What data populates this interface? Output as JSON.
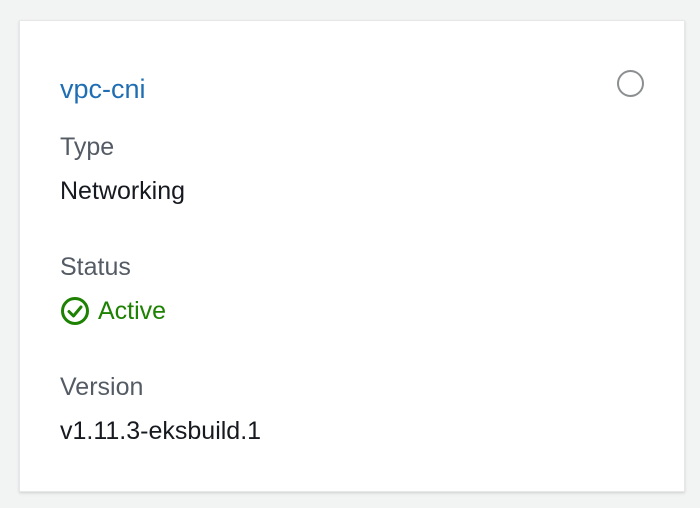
{
  "card": {
    "addon_name": "vpc-cni",
    "fields": {
      "type": {
        "label": "Type",
        "value": "Networking"
      },
      "status": {
        "label": "Status",
        "value": "Active",
        "icon": "check-circle-icon",
        "color": "#1d8102"
      },
      "version": {
        "label": "Version",
        "value": "v1.11.3-eksbuild.1"
      }
    },
    "selected": false
  },
  "colors": {
    "link": "#1f6eb3",
    "label": "#545b64",
    "value": "#16191f",
    "success": "#1d8102"
  }
}
